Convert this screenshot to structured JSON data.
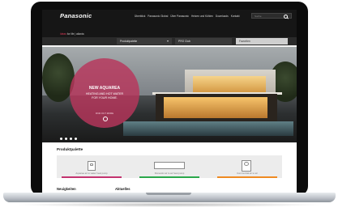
{
  "brand": {
    "logo": "Panasonic",
    "tagline_accent": "Ideas",
    "tagline_rest": " for life | atlanta"
  },
  "topnav": [
    "Überblick",
    "Panasonic Global",
    "Über Panasonic",
    "Heizen und Kühlen",
    "Downloads",
    "Kontakt"
  ],
  "search": {
    "placeholder": "Suche"
  },
  "menu": {
    "product_dropdown": "Produktpalette",
    "pro_club": "PRO Club",
    "favourites": "Favoriten"
  },
  "hero": {
    "title": "NEW AQUAREA",
    "line1": "HEATING AND HOT WATER",
    "line2": "FOR YOUR HOME.",
    "link": "FIND OUT MORE",
    "slides": 4
  },
  "products": {
    "section_title": "Produktpalette",
    "cards": [
      {
        "label": "Aquarea air to water heat pump",
        "color": "#c3336f"
      },
      {
        "label": "Domestic air to air heat pump",
        "color": "#2aa84a"
      },
      {
        "label": "Commercial air to air",
        "color": "#ef8a22"
      }
    ]
  },
  "bottom": {
    "news": "Neuigkeiten",
    "current": "Aktuelles"
  }
}
